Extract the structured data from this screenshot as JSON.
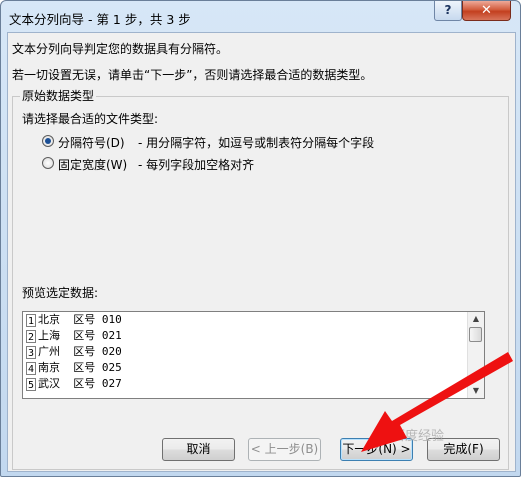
{
  "window": {
    "title": "文本分列向导 - 第 1 步，共 3 步",
    "help_label": "?",
    "close_label": "✕"
  },
  "intro": {
    "line1": "文本分列向导判定您的数据具有分隔符。",
    "line2": "若一切设置无误，请单击“下一步”，否则请选择最合适的数据类型。"
  },
  "group": {
    "title": "原始数据类型",
    "prompt": "请选择最合适的文件类型:",
    "options": [
      {
        "label": "分隔符号(D)",
        "desc": "- 用分隔字符，如逗号或制表符分隔每个字段",
        "selected": true
      },
      {
        "label": "固定宽度(W)",
        "desc": "- 每列字段加空格对齐",
        "selected": false
      }
    ]
  },
  "preview": {
    "label": "预览选定数据:",
    "rows": [
      {
        "num": "1",
        "text": "北京  区号 010"
      },
      {
        "num": "2",
        "text": "上海  区号 021"
      },
      {
        "num": "3",
        "text": "广州  区号 020"
      },
      {
        "num": "4",
        "text": "南京  区号 025"
      },
      {
        "num": "5",
        "text": "武汉  区号 027"
      }
    ],
    "scroll_up": "▲",
    "scroll_down": "▼"
  },
  "buttons": {
    "cancel": "取消",
    "back": "< 上一步(B)",
    "next": "下一步(N) >",
    "finish": "完成(F)"
  },
  "annotation": {
    "arrow_color": "#ee1111"
  },
  "watermark": {
    "text": "百度经验"
  }
}
